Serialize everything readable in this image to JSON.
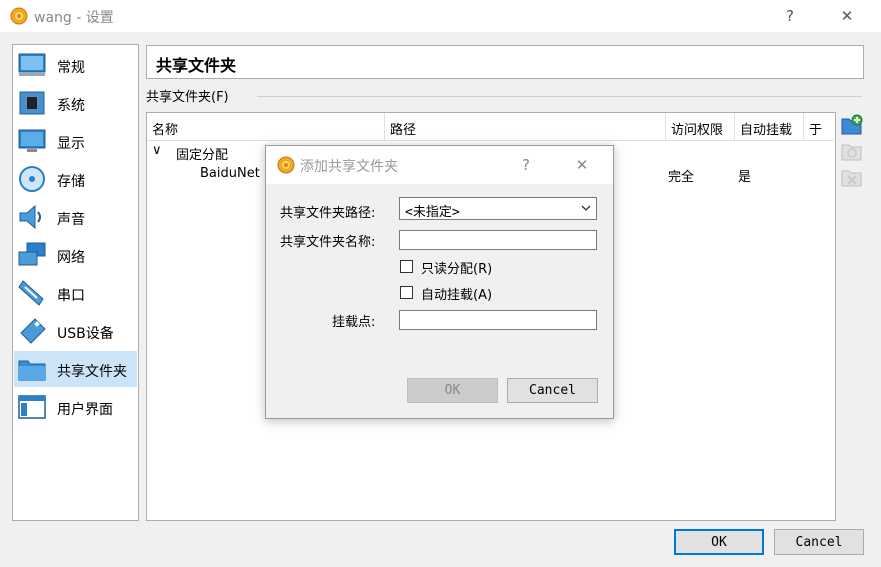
{
  "window": {
    "title": "wang - 设置",
    "help_glyph": "?",
    "close_glyph": "✕"
  },
  "sidebar": {
    "items": [
      {
        "label": "常规",
        "icon": "monitor-general-icon"
      },
      {
        "label": "系统",
        "icon": "chip-system-icon"
      },
      {
        "label": "显示",
        "icon": "display-icon"
      },
      {
        "label": "存储",
        "icon": "disk-storage-icon"
      },
      {
        "label": "声音",
        "icon": "speaker-icon"
      },
      {
        "label": "网络",
        "icon": "network-icon"
      },
      {
        "label": "串口",
        "icon": "serial-port-icon"
      },
      {
        "label": "USB设备",
        "icon": "usb-icon"
      },
      {
        "label": "共享文件夹",
        "icon": "shared-folder-icon"
      },
      {
        "label": "用户界面",
        "icon": "user-interface-icon"
      }
    ],
    "selected_index": 8
  },
  "section": {
    "title": "共享文件夹",
    "group_label": "共享文件夹(F)"
  },
  "table": {
    "columns": [
      "名称",
      "路径",
      "访问权限",
      "自动挂载",
      "于"
    ],
    "group_row": "固定分配",
    "group_toggle": "∨",
    "row": {
      "name": "BaiduNet",
      "access": "完全",
      "automount": "是"
    }
  },
  "dialog": {
    "title": "添加共享文件夹",
    "help_glyph": "?",
    "close_glyph": "✕",
    "path_label": "共享文件夹路径:",
    "path_value": "<未指定>",
    "name_label": "共享文件夹名称:",
    "name_value": "",
    "readonly_label": "只读分配(R)",
    "automount_label": "自动挂载(A)",
    "mountpoint_label": "挂载点:",
    "mountpoint_value": "",
    "ok_label": "OK",
    "cancel_label": "Cancel"
  },
  "footer": {
    "ok_label": "OK",
    "cancel_label": "Cancel"
  }
}
